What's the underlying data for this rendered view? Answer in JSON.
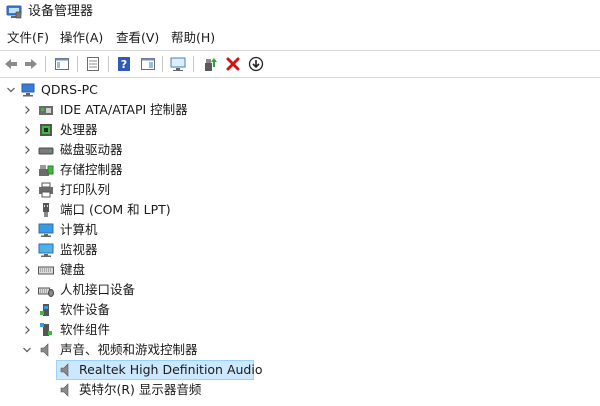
{
  "window": {
    "title": "设备管理器"
  },
  "menu": [
    {
      "label": "文件(F)"
    },
    {
      "label": "操作(A)"
    },
    {
      "label": "查看(V)"
    },
    {
      "label": "帮助(H)"
    }
  ],
  "toolbar": {
    "icons": [
      "back-arrow-icon",
      "forward-arrow-icon",
      "properties-panel-icon",
      "details-view-icon",
      "help-icon",
      "device-panel-icon",
      "scan-monitor-icon",
      "update-driver-icon",
      "uninstall-icon",
      "download-icon"
    ]
  },
  "tree": {
    "root": {
      "label": "QDRS-PC"
    },
    "categories": [
      {
        "label": "IDE ATA/ATAPI 控制器",
        "icon": "ide-controller-icon"
      },
      {
        "label": "处理器",
        "icon": "processor-icon"
      },
      {
        "label": "磁盘驱动器",
        "icon": "disk-drive-icon"
      },
      {
        "label": "存储控制器",
        "icon": "storage-controller-icon"
      },
      {
        "label": "打印队列",
        "icon": "printer-icon"
      },
      {
        "label": "端口 (COM 和 LPT)",
        "icon": "port-icon"
      },
      {
        "label": "计算机",
        "icon": "computer-icon"
      },
      {
        "label": "监视器",
        "icon": "monitor-icon"
      },
      {
        "label": "键盘",
        "icon": "keyboard-icon"
      },
      {
        "label": "人机接口设备",
        "icon": "hid-icon"
      },
      {
        "label": "软件设备",
        "icon": "software-device-icon"
      },
      {
        "label": "软件组件",
        "icon": "software-component-icon"
      },
      {
        "label": "声音、视频和游戏控制器",
        "icon": "speaker-icon",
        "expanded": true,
        "children": [
          {
            "label": "Realtek High Definition Audio",
            "icon": "speaker-icon",
            "selected": true
          },
          {
            "label": "英特尔(R) 显示器音频",
            "icon": "speaker-icon"
          }
        ]
      }
    ]
  }
}
